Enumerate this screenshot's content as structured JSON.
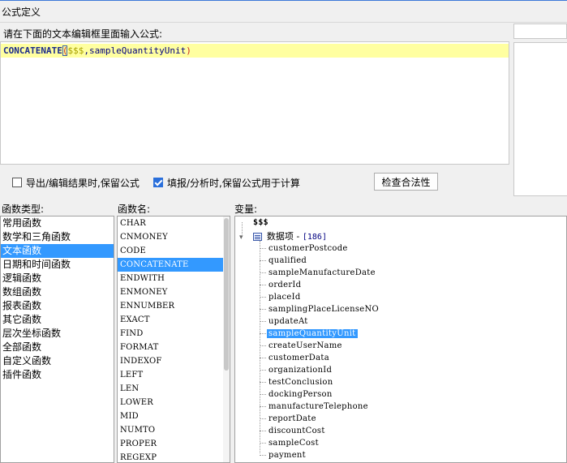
{
  "window": {
    "title": "公式定义"
  },
  "editor": {
    "prompt": "请在下面的文本编辑框里面输入公式:",
    "formula": {
      "function": "CONCATENATE",
      "open_paren": "(",
      "variable": "$$$",
      "rest": ",sampleQuantityUnit",
      "close_paren": ")"
    }
  },
  "options": {
    "keep_formula_export": {
      "label": "导出/编辑结果时,保留公式",
      "checked": false
    },
    "keep_formula_calc": {
      "label": "填报/分析时,保留公式用于计算",
      "checked": true
    },
    "check_button": "检查合法性"
  },
  "categories": {
    "header": "函数类型:",
    "selected_index": 2,
    "items": [
      "常用函数",
      "数学和三角函数",
      "文本函数",
      "日期和时间函数",
      "逻辑函数",
      "数组函数",
      "报表函数",
      "其它函数",
      "层次坐标函数",
      "全部函数",
      "自定义函数",
      "插件函数"
    ]
  },
  "functions": {
    "header": "函数名:",
    "selected_index": 3,
    "items": [
      "CHAR",
      "CNMONEY",
      "CODE",
      "CONCATENATE",
      "ENDWITH",
      "ENMONEY",
      "ENNUMBER",
      "EXACT",
      "FIND",
      "FORMAT",
      "INDEXOF",
      "LEFT",
      "LEN",
      "LOWER",
      "MID",
      "NUMTO",
      "PROPER",
      "REGEXP"
    ]
  },
  "variables": {
    "header": "变量:",
    "root": "$$$",
    "group": {
      "toggle": "▾",
      "label": "数据项",
      "separator": " - ",
      "count": "[186]"
    },
    "selected_index": 9,
    "items": [
      "customerPostcode",
      "qualified",
      "sampleManufactureDate",
      "orderId",
      "placeId",
      "samplingPlaceLicenseNO",
      "updateAt",
      "sampleQuantityUnit",
      "createUserName",
      "customerData",
      "organizationId",
      "testConclusion",
      "dockingPerson",
      "manufactureTelephone",
      "reportDate",
      "discountCost",
      "sampleCost",
      "payment"
    ]
  }
}
